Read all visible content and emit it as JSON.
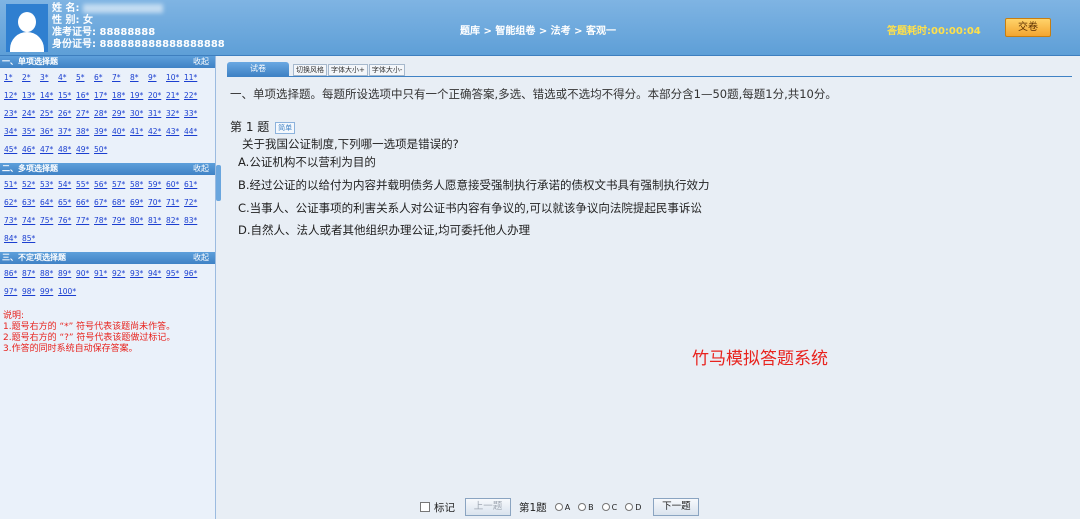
{
  "header": {
    "name_label": "姓 名:",
    "gender_label": "性 别:",
    "gender_value": "女",
    "exam_id_label": "准考证号:",
    "exam_id_value": "88888888",
    "id_card_label": "身份证号:",
    "id_card_value": "888888888888888888",
    "breadcrumb": "题库 > 智能组卷 > 法考 > 客观一",
    "timer": "答题耗时:00:00:04",
    "submit_label": "交卷"
  },
  "sidebar": {
    "collapse_label": "收起",
    "sections": [
      {
        "title": "一、单项选择题",
        "items": [
          "1*",
          "2*",
          "3*",
          "4*",
          "5*",
          "6*",
          "7*",
          "8*",
          "9*",
          "10*",
          "11*",
          "12*",
          "13*",
          "14*",
          "15*",
          "16*",
          "17*",
          "18*",
          "19*",
          "20*",
          "21*",
          "22*",
          "23*",
          "24*",
          "25*",
          "26*",
          "27*",
          "28*",
          "29*",
          "30*",
          "31*",
          "32*",
          "33*",
          "34*",
          "35*",
          "36*",
          "37*",
          "38*",
          "39*",
          "40*",
          "41*",
          "42*",
          "43*",
          "44*",
          "45*",
          "46*",
          "47*",
          "48*",
          "49*",
          "50*"
        ]
      },
      {
        "title": "二、多项选择题",
        "items": [
          "51*",
          "52*",
          "53*",
          "54*",
          "55*",
          "56*",
          "57*",
          "58*",
          "59*",
          "60*",
          "61*",
          "62*",
          "63*",
          "64*",
          "65*",
          "66*",
          "67*",
          "68*",
          "69*",
          "70*",
          "71*",
          "72*",
          "73*",
          "74*",
          "75*",
          "76*",
          "77*",
          "78*",
          "79*",
          "80*",
          "81*",
          "82*",
          "83*",
          "84*",
          "85*"
        ]
      },
      {
        "title": "三、不定项选择题",
        "items": [
          "86*",
          "87*",
          "88*",
          "89*",
          "90*",
          "91*",
          "92*",
          "93*",
          "94*",
          "95*",
          "96*",
          "97*",
          "98*",
          "99*",
          "100*"
        ]
      }
    ],
    "notes": [
      "说明:",
      "1.题号右方的 “*” 符号代表该题尚未作答。",
      "2.题号右方的 “?” 符号代表该题做过标记。",
      "3.作答的同时系统自动保存答案。"
    ]
  },
  "main": {
    "tab_active": "试卷",
    "tab_buttons": [
      "切换风格",
      "字体大小+",
      "字体大小-"
    ],
    "instruction": "一、单项选择题。每题所设选项中只有一个正确答案,多选、错选或不选均不得分。本部分含1—50题,每题1分,共10分。",
    "question_number": "第 1 题",
    "difficulty_tag": "简单",
    "stem": "关于我国公证制度,下列哪一选项是错误的?",
    "options": [
      "A.公证机构不以营利为目的",
      "B.经过公证的以给付为内容并载明债务人愿意接受强制执行承诺的债权文书具有强制执行效力",
      "C.当事人、公证事项的利害关系人对公证书内容有争议的,可以就该争议向法院提起民事诉讼",
      "D.自然人、法人或者其他组织办理公证,均可委托他人办理"
    ],
    "watermark": "竹马模拟答题系统"
  },
  "bottom": {
    "mark_label": "标记",
    "prev_label": "上一题",
    "current_label": "第1题",
    "choices": [
      "A",
      "B",
      "C",
      "D"
    ],
    "next_label": "下一题"
  }
}
